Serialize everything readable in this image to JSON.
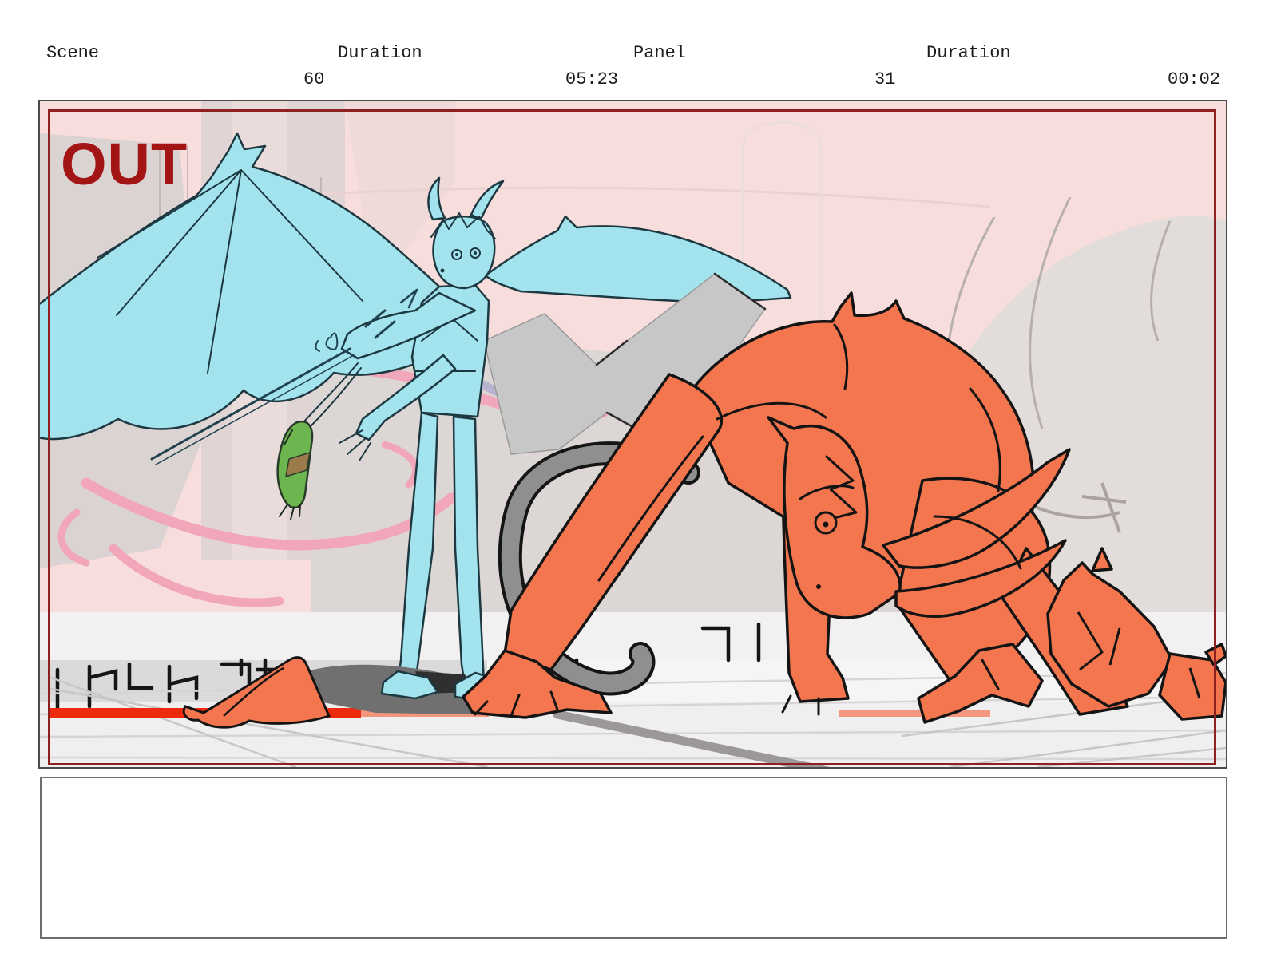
{
  "header": {
    "columns": [
      {
        "label": "Scene",
        "value": "60"
      },
      {
        "label": "Duration",
        "value": "05:23"
      },
      {
        "label": "Panel",
        "value": "31"
      },
      {
        "label": "Duration",
        "value": "00:02"
      }
    ]
  },
  "panel": {
    "overlay_label": "OUT",
    "palette": {
      "frame_red": "#8e2022",
      "out_red": "#a31515",
      "sky_pink": "#f8dddd",
      "figure_cyan": "#a2e3ee",
      "figure_cyan_outline": "#1d3840",
      "demon_orange": "#f4764e",
      "outline_black": "#141414",
      "floor_stripe_red": "#ee2a0e",
      "ribbon_pink": "#f2a6ba",
      "tassel_green": "#6db64f",
      "tail_gray": "#8f8f8f",
      "wing_gray": "#c7c7c7"
    }
  },
  "notes": {
    "text": ""
  }
}
